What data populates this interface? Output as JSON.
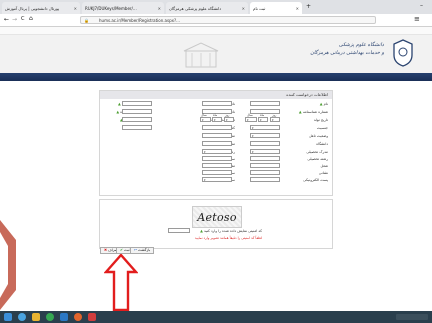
{
  "browser": {
    "tabs": [
      {
        "label": "پورتال دانشجویی | پرتال آموزش"
      },
      {
        "label": "RUKJ7/DUKeys/Member/..."
      },
      {
        "label": "دانشگاه علوم پزشکی هرمزگان"
      },
      {
        "label": "ثبت نام"
      }
    ],
    "url": "hums.ac.ir/Member/Registration.aspx?...",
    "new_tab": "+",
    "min": "–",
    "back": "←",
    "forward": "→",
    "reload": "C",
    "home": "⌂",
    "menu": "≡"
  },
  "site": {
    "logo_line1": "دانشگاه علوم پزشکی",
    "logo_line2": "و خدمات بهداشتی درمانی هرمزگان"
  },
  "form": {
    "title": "اطلاعات درخواست کننده",
    "right_col": [
      "نام",
      "شماره شناسنامه",
      "تاریخ تولد",
      "جنسیت",
      "وضعیت تاهل",
      "دانشگاه",
      "مدرک تحصیلی",
      "رشته تحصیلی",
      "شغل",
      "نشانی",
      "پست الکترونیکی"
    ],
    "mid_col": [
      "نام خانوادگی",
      "نام پدر",
      "تاریخ صدور شناسنامه",
      "کد ملی",
      "محل صدور شناسنامه",
      "محل تولد",
      "رشته تحصیلی",
      "سمت",
      "مقطع تحصیلی",
      "سابقه کار",
      "سطح آموزشی"
    ],
    "left_col": [
      "کد کاربری",
      "تلفن همراه",
      "کد پستی",
      "تلفن ثابت"
    ],
    "date_parts": [
      "سال",
      "ماه",
      "روز"
    ],
    "captcha_text": "Aetoso",
    "captcha_label": "کد امنیتی نمایش داده شده را وارد کنید",
    "captcha_note": "لطفاً کد امنیتی را دقیقاً همانند تصویر وارد نمایید"
  },
  "buttons": {
    "back": "بازگشت",
    "save": "ثبت",
    "cancel": "انصراف"
  },
  "colors": {
    "nav": "#1f355f",
    "arrow": "#e21d1d",
    "accent_green": "#4a9d2e",
    "taskbar": "#2a3f4d"
  }
}
